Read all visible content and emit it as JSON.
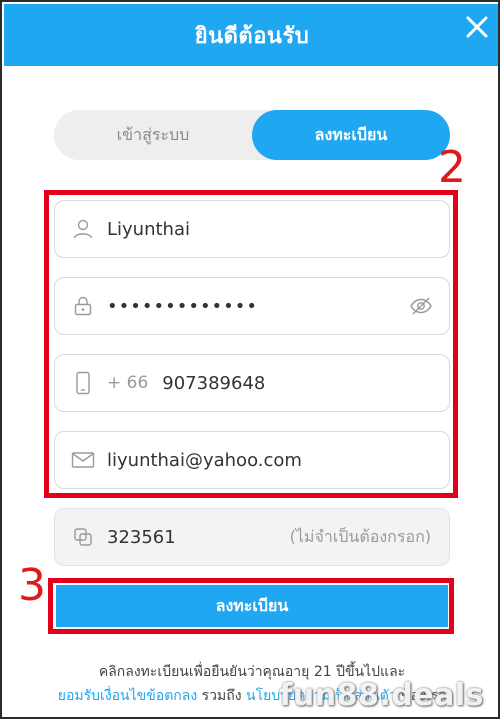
{
  "header": {
    "title": "ยินดีต้อนรับ"
  },
  "tabs": {
    "login": "เข้าสู่ระบบ",
    "register": "ลงทะเบียน"
  },
  "annotations": {
    "step2": "2",
    "step3": "3"
  },
  "form": {
    "username": "Liyunthai",
    "password": "•••••••••••••",
    "phone_prefix": "+ 66",
    "phone": "907389648",
    "email": "liyunthai@yahoo.com",
    "referral": "323561",
    "referral_hint": "(ไม่จำเป็นต้องกรอก)"
  },
  "submit_label": "ลงทะเบียน",
  "terms": {
    "line1": "คลิกลงทะเบียนเพื่อยืนยันว่าคุณอายุ 21 ปีขึ้นไปและ",
    "link1": "ยอมรับเงื่อนไขข้อตกลง",
    "mid": " รวมถึง ",
    "link2": "นโยบายความเป็นส่วนตัว",
    "tail": " ของเรา"
  },
  "watermark": "fun88.deals",
  "colors": {
    "brand": "#1fa7f2",
    "annotation": "#e3001b"
  },
  "icons": [
    "close-icon",
    "user-icon",
    "lock-icon",
    "eye-off-icon",
    "phone-icon",
    "mail-icon",
    "referral-icon"
  ]
}
